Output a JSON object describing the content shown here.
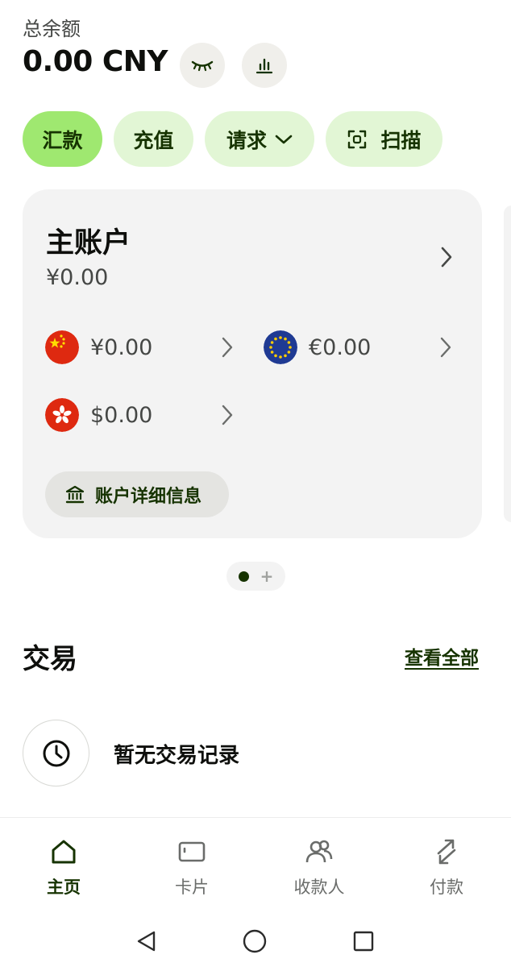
{
  "header": {
    "balance_label": "总余额",
    "balance_amount": "0.00 CNY",
    "icons": {
      "hide_balance": "eye-closed-icon",
      "insights": "bar-chart-icon"
    }
  },
  "actions": [
    {
      "label": "汇款",
      "primary": true
    },
    {
      "label": "充值",
      "primary": false
    },
    {
      "label": "请求",
      "primary": false,
      "icon": "chevron-down-icon"
    },
    {
      "label": "扫描",
      "primary": false,
      "icon": "scan-icon"
    }
  ],
  "account": {
    "title": "主账户",
    "balance": "¥0.00",
    "currencies": [
      {
        "code": "CNY",
        "amount": "¥0.00",
        "icon": "china-flag-icon"
      },
      {
        "code": "EUR",
        "amount": "€0.00",
        "icon": "eu-flag-icon"
      },
      {
        "code": "HKD",
        "amount": "$0.00",
        "icon": "hong-kong-flag-icon"
      }
    ],
    "details_label": "账户详细信息"
  },
  "transactions": {
    "title": "交易",
    "see_all": "查看全部",
    "empty_text": "暂无交易记录"
  },
  "nav": [
    {
      "label": "主页",
      "active": true,
      "icon": "home-icon"
    },
    {
      "label": "卡片",
      "active": false,
      "icon": "card-icon"
    },
    {
      "label": "收款人",
      "active": false,
      "icon": "recipients-icon"
    },
    {
      "label": "付款",
      "active": false,
      "icon": "transfer-icon"
    }
  ],
  "colors": {
    "accent": "#9fe870",
    "accent_soft": "#e2f6d5",
    "forest": "#163300",
    "card_bg": "#f3f3f3",
    "text_primary": "#0e0f0c",
    "text_secondary": "#454745"
  }
}
